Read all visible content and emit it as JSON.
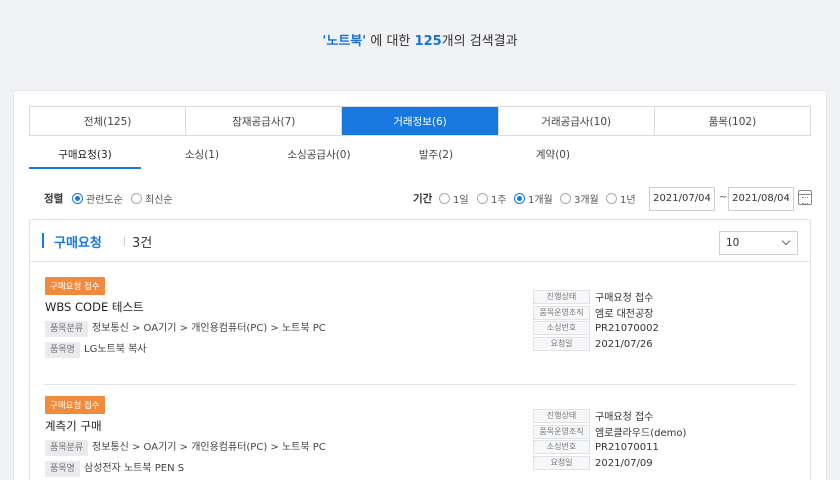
{
  "header": {
    "keyword": "'노트북'",
    "middle": " 에 대한 ",
    "count": "125",
    "suffix": "개의 검색결과"
  },
  "tabs": [
    {
      "label": "전체(125)",
      "active": false
    },
    {
      "label": "잠재공급사(7)",
      "active": false
    },
    {
      "label": "거래정보(6)",
      "active": true
    },
    {
      "label": "거래공급사(10)",
      "active": false
    },
    {
      "label": "품목(102)",
      "active": false
    }
  ],
  "subtabs": [
    {
      "label": "구매요청(3)",
      "active": true
    },
    {
      "label": "소싱(1)",
      "active": false
    },
    {
      "label": "소싱공급사(0)",
      "active": false
    },
    {
      "label": "발주(2)",
      "active": false
    },
    {
      "label": "계약(0)",
      "active": false
    }
  ],
  "filters": {
    "sort_label": "정렬",
    "sort_options": [
      {
        "label": "관련도순",
        "selected": true
      },
      {
        "label": "최신순",
        "selected": false
      }
    ],
    "period_label": "기간",
    "period_options": [
      {
        "label": "1일",
        "selected": false
      },
      {
        "label": "1주",
        "selected": false
      },
      {
        "label": "1개월",
        "selected": true
      },
      {
        "label": "3개월",
        "selected": false
      },
      {
        "label": "1년",
        "selected": false
      }
    ],
    "date_from": "2021/07/04",
    "tilde": "~",
    "date_to": "2021/08/04"
  },
  "result": {
    "title": "구매요청",
    "count": "3건",
    "page_size": "10",
    "items": [
      {
        "badge": "구매요청 접수",
        "name": "WBS CODE 테스트",
        "category_label": "품목분류",
        "category": "정보통신 > OA기기 > 개인용컴퓨터(PC) > 노트북 PC",
        "item_label": "품목명",
        "item_name": "LG노트북 복사",
        "status_label": "진행상태",
        "status": "구매요청 접수",
        "org_label": "품목운영조직",
        "org": "엠로 대전공장",
        "no_label": "소싱번호",
        "no": "PR21070002",
        "date_label": "요청일",
        "date": "2021/07/26"
      },
      {
        "badge": "구매요청 접수",
        "name": "계측기 구매",
        "category_label": "품목분류",
        "category": "정보통신 > OA기기 > 개인용컴퓨터(PC) > 노트북 PC",
        "item_label": "품목명",
        "item_name": "삼성전자 노트북 PEN S",
        "status_label": "진행상태",
        "status": "구매요청 접수",
        "org_label": "품목운영조직",
        "org": "엠로클라우드(demo)",
        "no_label": "소싱번호",
        "no": "PR21070011",
        "date_label": "요청일",
        "date": "2021/07/09"
      }
    ]
  },
  "colors": {
    "accent": "#1878e0",
    "badge": "#f08a3c",
    "background": "#f1f2f4"
  }
}
